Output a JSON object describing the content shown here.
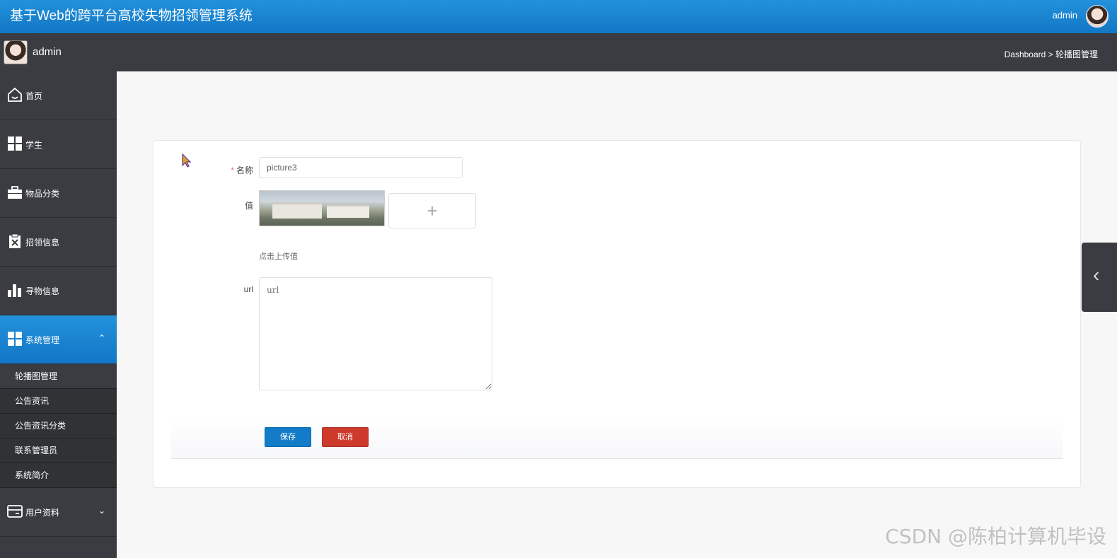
{
  "header": {
    "title": "基于Web的跨平台高校失物招领管理系统",
    "user": "admin",
    "avatar_icon": "avatar-icon"
  },
  "subbar": {
    "user": "admin",
    "breadcrumb": "Dashboard > 轮播图管理"
  },
  "sidebar": {
    "items": [
      {
        "label": "首页",
        "icon": "home-icon"
      },
      {
        "label": "学生",
        "icon": "grid-icon"
      },
      {
        "label": "物品分类",
        "icon": "briefcase-icon"
      },
      {
        "label": "招领信息",
        "icon": "clipboard-icon"
      },
      {
        "label": "寻物信息",
        "icon": "bar-chart-icon"
      },
      {
        "label": "系统管理",
        "icon": "grid-icon",
        "active": true,
        "expanded": true
      },
      {
        "label": "用户资料",
        "icon": "card-icon"
      }
    ],
    "subitems": [
      "轮播图管理",
      "公告资讯",
      "公告资讯分类",
      "联系管理员",
      "系统简介"
    ]
  },
  "form": {
    "name_label": "名称",
    "name_value": "picture3",
    "value_label": "值",
    "upload_hint": "点击上传值",
    "url_label": "url",
    "url_placeholder": "url",
    "save_label": "保存",
    "cancel_label": "取消"
  },
  "watermark": "CSDN @陈柏计算机毕设",
  "colors": {
    "primary": "#137bc8",
    "danger": "#cd3a2c",
    "sidebar": "#3a3c42"
  }
}
